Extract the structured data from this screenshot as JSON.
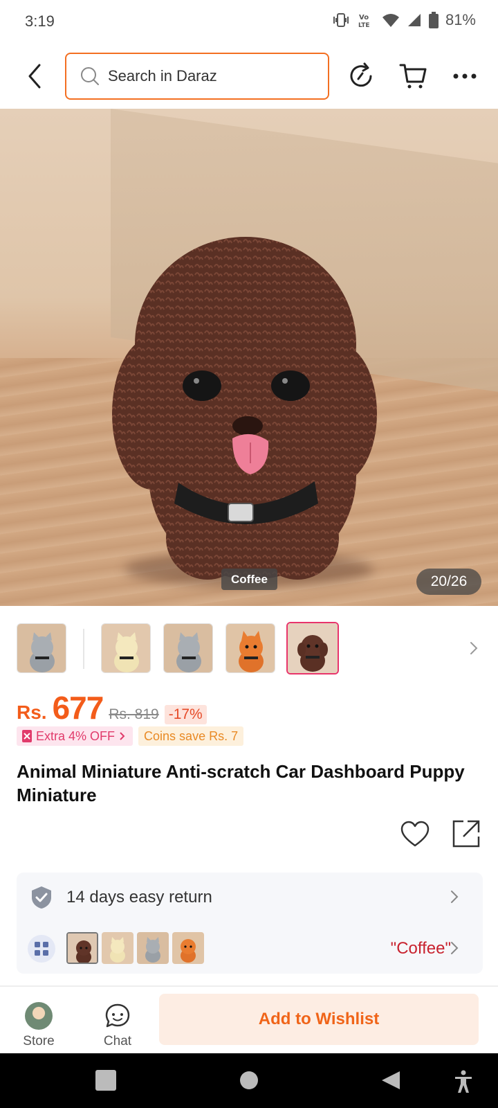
{
  "status_bar": {
    "time": "3:19",
    "battery": "81%",
    "icons": [
      "vibrate-icon",
      "volte-icon",
      "wifi-icon",
      "signal-icon",
      "battery-icon"
    ]
  },
  "top_bar": {
    "back_icon": "chevron-left-icon",
    "search_placeholder": "Search in Daraz",
    "icons": [
      "refresh-icon",
      "cart-icon",
      "more-icon"
    ]
  },
  "gallery": {
    "current_variant_caption": "Coffee",
    "counter": "20/26",
    "thumbnails": [
      "grey-kitten",
      "cream-kitten",
      "grey-kitten",
      "orange-pomeranian",
      "coffee-poodle"
    ],
    "active_thumbnail_index": 4
  },
  "price": {
    "currency": "Rs.",
    "current": "677",
    "original": "Rs. 819",
    "discount": "-17%"
  },
  "promos": {
    "voucher": "Extra 4% OFF",
    "coins": "Coins save Rs. 7"
  },
  "product": {
    "title": "Animal Miniature Anti-scratch Car Dashboard Puppy Miniature"
  },
  "service": {
    "return_label": "14 days easy return",
    "selected_variant": "\"Coffee\""
  },
  "bottom_bar": {
    "store_label": "Store",
    "chat_label": "Chat",
    "wishlist_label": "Add to Wishlist"
  },
  "colors": {
    "brand_orange": "#f36f21",
    "price_orange": "#f35c1a",
    "variant_red": "#c8222e",
    "voucher_pink": "#e13b6b"
  }
}
